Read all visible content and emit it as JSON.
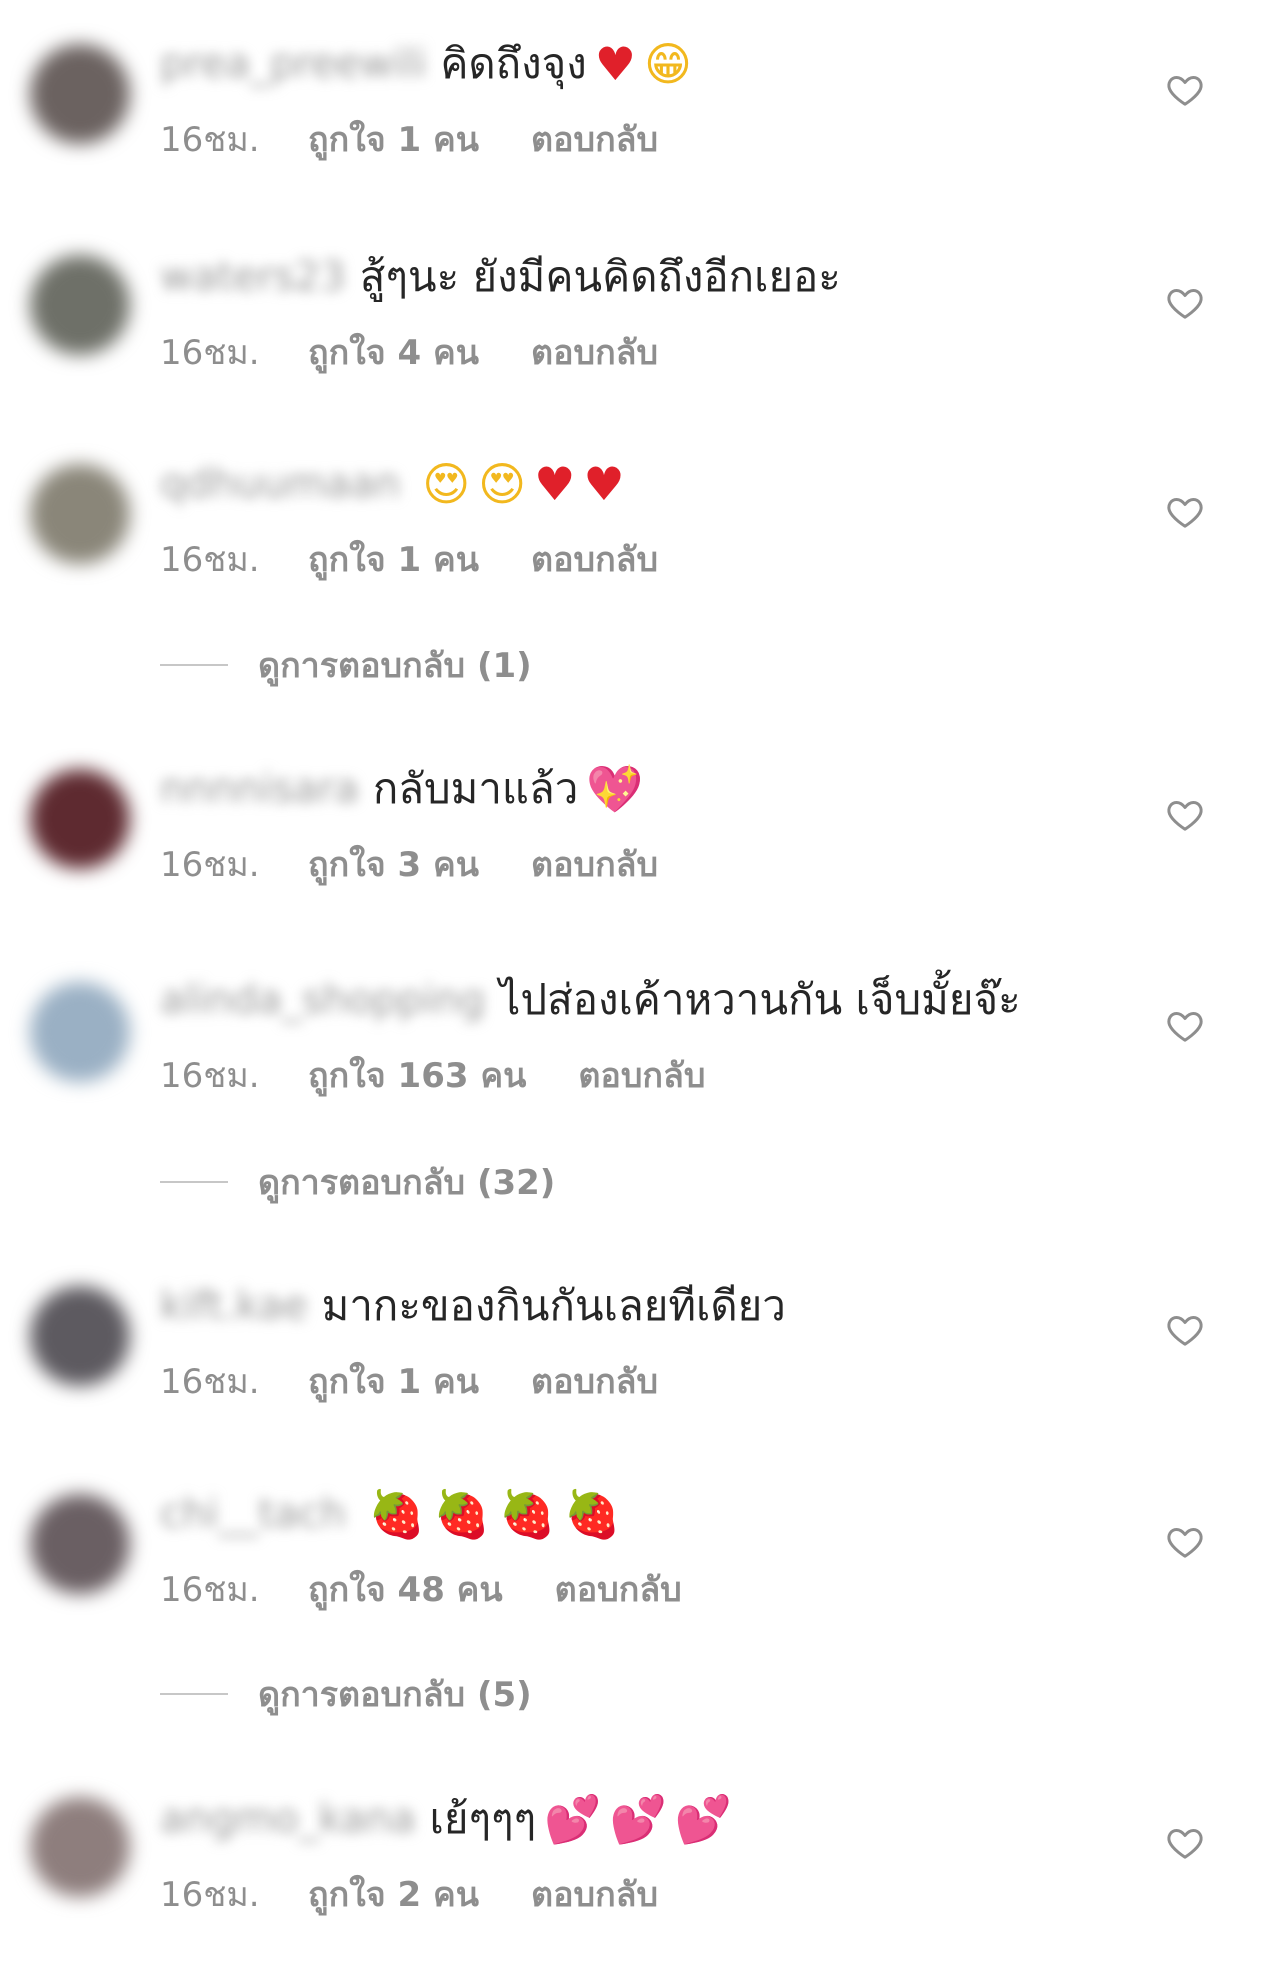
{
  "reply_label": "ตอบกลับ",
  "comments": [
    {
      "username": "prea_preewili",
      "text": "คิดถึงจุง",
      "emojis": [
        {
          "char": "♥",
          "color": "red"
        },
        {
          "char": "😁",
          "color": "yellow"
        }
      ],
      "time": "16ชม.",
      "likes": "ถูกใจ 1 คน",
      "avatar_color": "#6b6260"
    },
    {
      "username": "waters23",
      "text": "สู้ๆนะ ยังมีคนคิดถึงอีกเยอะ",
      "emojis": [],
      "time": "16ชม.",
      "likes": "ถูกใจ 4 คน",
      "avatar_color": "#6e7068"
    },
    {
      "username": "qdhuumaan",
      "text": "",
      "emojis": [
        {
          "char": "😍",
          "color": "yellow"
        },
        {
          "char": "😍",
          "color": "yellow"
        },
        {
          "char": "♥",
          "color": "red"
        },
        {
          "char": "♥",
          "color": "red"
        }
      ],
      "time": "16ชม.",
      "likes": "ถูกใจ 1 คน",
      "avatar_color": "#8a8679"
    },
    {
      "username": "nnnnisara",
      "text": "กลับมาแล้ว",
      "emojis": [
        {
          "char": "💖",
          "color": "pink"
        }
      ],
      "time": "16ชม.",
      "likes": "ถูกใจ 3 คน",
      "avatar_color": "#5e2a30"
    },
    {
      "username": "alinda_shopping",
      "text": "ไปส่องเค้าหวานกัน เจ็บมั้ยจ๊ะ",
      "emojis": [],
      "time": "16ชม.",
      "likes": "ถูกใจ 163 คน",
      "avatar_color": "#9ab0c4"
    },
    {
      "username": "kift.kae",
      "text": "มากะของกินกันเลยทีเดียว",
      "emojis": [],
      "time": "16ชม.",
      "likes": "ถูกใจ 1 คน",
      "avatar_color": "#5d5a60"
    },
    {
      "username": "chi__tach",
      "text": "",
      "emojis": [
        {
          "char": "🍓",
          "color": "red"
        },
        {
          "char": "🍓",
          "color": "red"
        },
        {
          "char": "🍓",
          "color": "red"
        },
        {
          "char": "🍓",
          "color": "red"
        }
      ],
      "time": "16ชม.",
      "likes": "ถูกใจ 48 คน",
      "avatar_color": "#6a5f63"
    },
    {
      "username": "angmo_kana",
      "text": "เย้ๆๆๆ",
      "emojis": [
        {
          "char": "💕",
          "color": "pink"
        },
        {
          "char": "💕",
          "color": "pink"
        },
        {
          "char": "💕",
          "color": "pink"
        }
      ],
      "time": "16ชม.",
      "likes": "ถูกใจ 2 คน",
      "avatar_color": "#8e7e7d"
    }
  ],
  "view_replies": [
    {
      "label": "ดูการตอบกลับ (1)"
    },
    {
      "label": "ดูการตอบกลับ (32)"
    },
    {
      "label": "ดูการตอบกลับ (5)"
    }
  ]
}
